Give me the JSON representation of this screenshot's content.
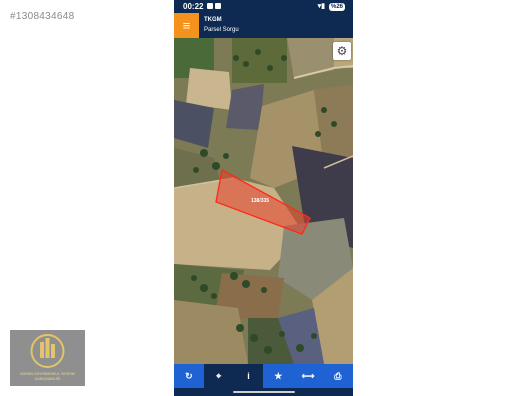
{
  "watermark": "#1308434648",
  "logo": {
    "line1": "BORAN GAYRİMENKUL YATIRIM",
    "line2": "DANIŞMANLIĞI"
  },
  "status_bar": {
    "time": "00:22",
    "battery": "%26"
  },
  "app_bar": {
    "menu_icon": "menu-icon",
    "title": "TKGM",
    "subtitle": "Parsel Sorgu"
  },
  "map": {
    "settings_icon": "gear-icon",
    "parcel_label": "138/335",
    "parcel_color": "#e8412f"
  },
  "toolbar": {
    "buttons": [
      {
        "icon": "refresh-icon",
        "glyph": "↻"
      },
      {
        "icon": "locate-icon",
        "glyph": "⌖"
      },
      {
        "icon": "info-icon",
        "glyph": "i"
      },
      {
        "icon": "star-icon",
        "glyph": "★"
      },
      {
        "icon": "measure-icon",
        "glyph": "⟷"
      },
      {
        "icon": "print-icon",
        "glyph": "⎙"
      }
    ]
  },
  "colors": {
    "app_bar": "#0e2a52",
    "menu_button": "#f5921e",
    "toolbar": "#1f62d4"
  }
}
